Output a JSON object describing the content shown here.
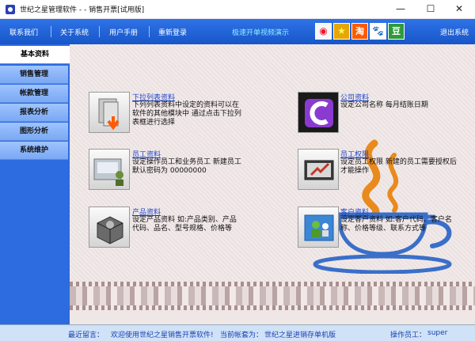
{
  "window": {
    "title": "世纪之星管理软件 -  - 销售开票[试用版]",
    "minimize_glyph": "—",
    "maximize_glyph": "☐",
    "close_glyph": "✕"
  },
  "topbar": {
    "menu": [
      "联系我们",
      "关于系统",
      "用户手册",
      "重新登录"
    ],
    "promo": "极速开单视频演示",
    "social": {
      "weibo": "◉",
      "star": "★",
      "tao": "淘",
      "paw": "🐾",
      "dou": "豆"
    },
    "exit_label": "退出系统"
  },
  "leftnav": {
    "items": [
      "基本资料",
      "销售管理",
      "帐款管理",
      "报表分析",
      "图形分析",
      "系统维护"
    ],
    "active_index": 0
  },
  "tiles": [
    {
      "id": "dropdown-list",
      "title": "下拉列表资料",
      "desc": "下列列表资料中设定的资料可以在软件的其他模块中 通过点击下拉列表框进行选择",
      "icon": "folder-arrow-icon"
    },
    {
      "id": "company",
      "title": "公司资料",
      "desc": "设定公司名称  每月结账日期",
      "icon": "company-logo-icon"
    },
    {
      "id": "staff",
      "title": "员工资料",
      "desc": "设定操作员工和业务员工  新建员工默认密码为 00000000",
      "icon": "staff-folder-icon"
    },
    {
      "id": "permissions",
      "title": "员工权限",
      "desc": "设定员工权限  新建的员工需要授权后才能操作",
      "icon": "permission-pen-icon"
    },
    {
      "id": "products",
      "title": "产品资料",
      "desc": "设定产品资料  如:产品类别、产品代码、品名、型号规格、价格等",
      "icon": "product-box-icon"
    },
    {
      "id": "customers",
      "title": "客户资料",
      "desc": "设定客户资料  如:客户代码、客户名称、价格等级、联系方式等",
      "icon": "customer-people-icon"
    }
  ],
  "status": {
    "message_label": "最近留言：",
    "message": "欢迎使用世纪之星销售开票软件!",
    "account_label": "当前帐套为：",
    "account": "世纪之星进销存单机版",
    "operator_label": "操作员工：",
    "operator": "super"
  },
  "colors": {
    "topbar": "#1e62d6",
    "nav": "#2d6be0",
    "link": "#1d44c8",
    "main_bg": "#efe6e6"
  }
}
